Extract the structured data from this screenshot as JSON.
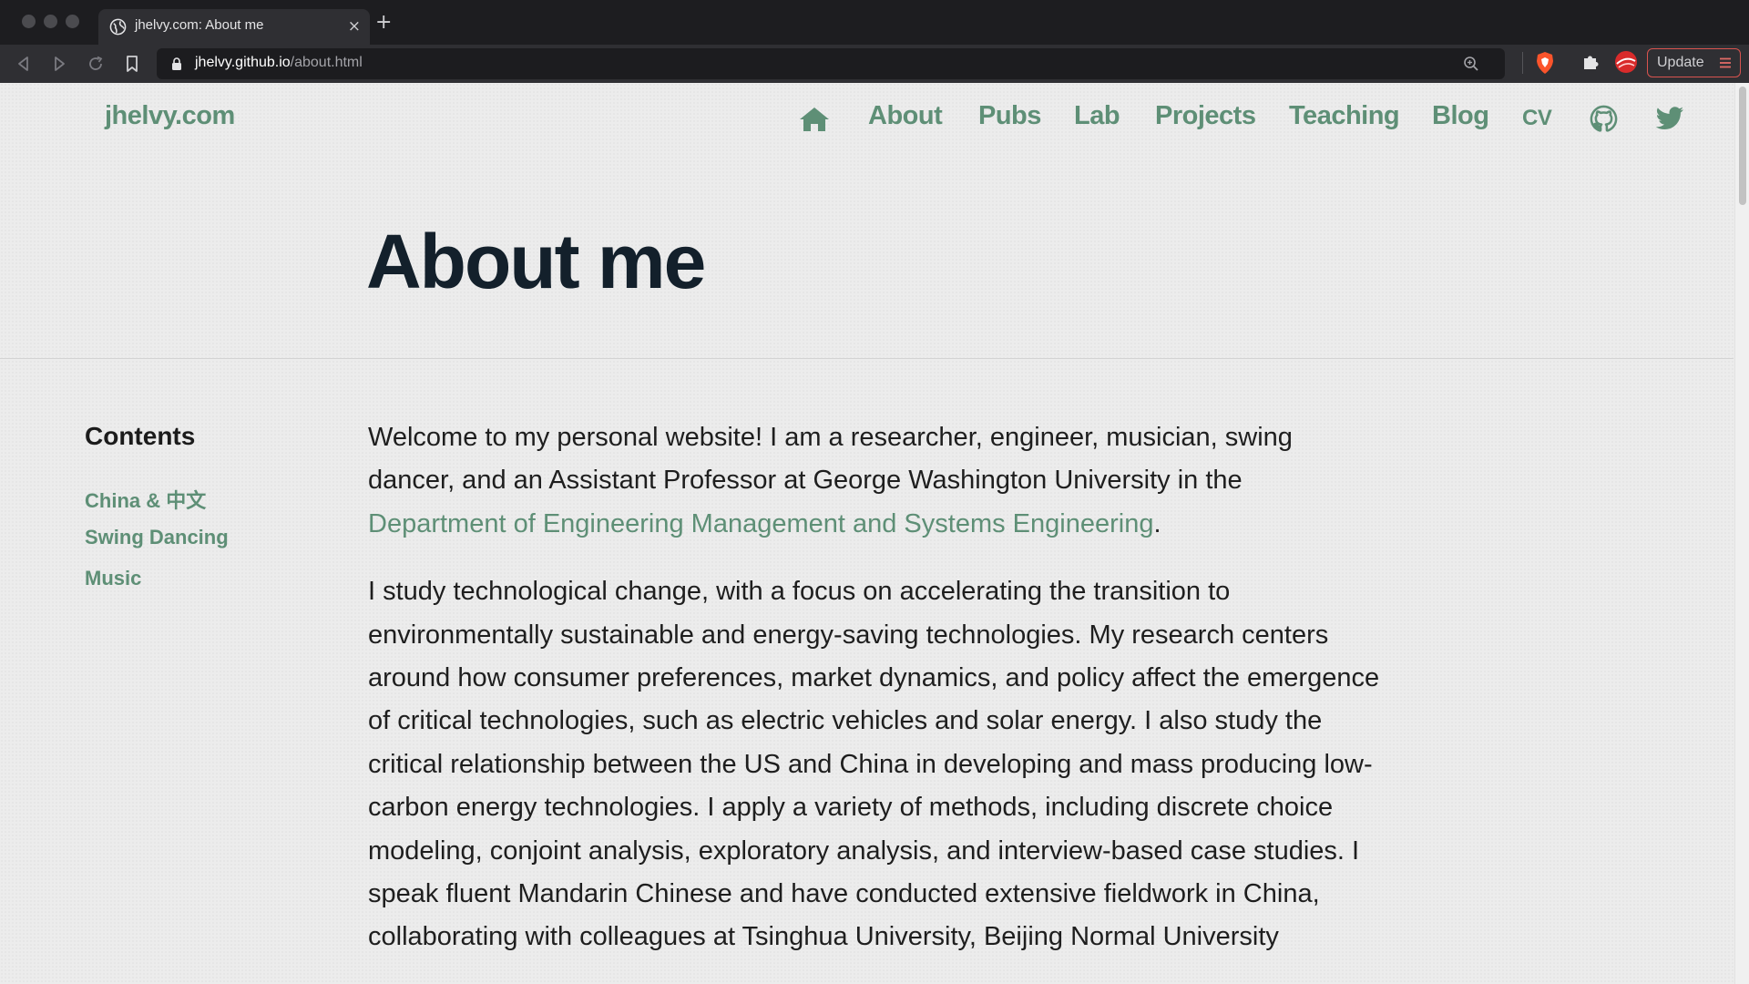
{
  "browser": {
    "tab": {
      "title": "jhelvy.com: About me",
      "close_glyph": "×"
    },
    "new_tab_glyph": "+",
    "url": {
      "host": "jhelvy.github.io",
      "path": "/about.html"
    },
    "update_label": "Update",
    "icons": {
      "back": "back-arrow-icon",
      "forward": "forward-arrow-icon",
      "reload": "reload-icon",
      "bookmark": "bookmark-icon",
      "lock": "lock-icon",
      "zoom": "zoom-icon",
      "shields": "brave-shields-icon",
      "extensions": "puzzle-icon",
      "profile": "profile-avatar-icon",
      "menu": "hamburger-menu-icon"
    }
  },
  "site": {
    "title": "jhelvy.com",
    "nav": {
      "home_icon": "home-icon",
      "items": [
        "About",
        "Pubs",
        "Lab",
        "Projects",
        "Teaching",
        "Blog"
      ],
      "cv": "CV",
      "github_icon": "github-icon",
      "twitter_icon": "twitter-icon"
    },
    "accent_color": "#5e8f76"
  },
  "page": {
    "title": "About me",
    "toc": {
      "heading": "Contents",
      "items": [
        "China & 中文",
        "Swing Dancing",
        "Music"
      ]
    },
    "paragraph1": {
      "text": "Welcome to my personal website! I am a researcher, engineer, musician, swing dancer, and an Assistant Professor at George Washington University in the ",
      "link": "Department of Engineering Management and Systems Engineering",
      "end": "."
    },
    "paragraph2": "I study technological change, with a focus on accelerating the transition to environmentally sustainable and energy-saving technologies. My research centers around how consumer preferences, market dynamics, and policy affect the emergence of critical technologies, such as electric vehicles and solar energy. I also study the critical relationship between the US and China in developing and mass producing low-carbon energy technologies. I apply a variety of methods, including discrete choice modeling, conjoint analysis, exploratory analysis, and interview-based case studies. I speak fluent Mandarin Chinese and have conducted extensive fieldwork in China, collaborating with colleagues at Tsinghua University, Beijing Normal University"
  }
}
